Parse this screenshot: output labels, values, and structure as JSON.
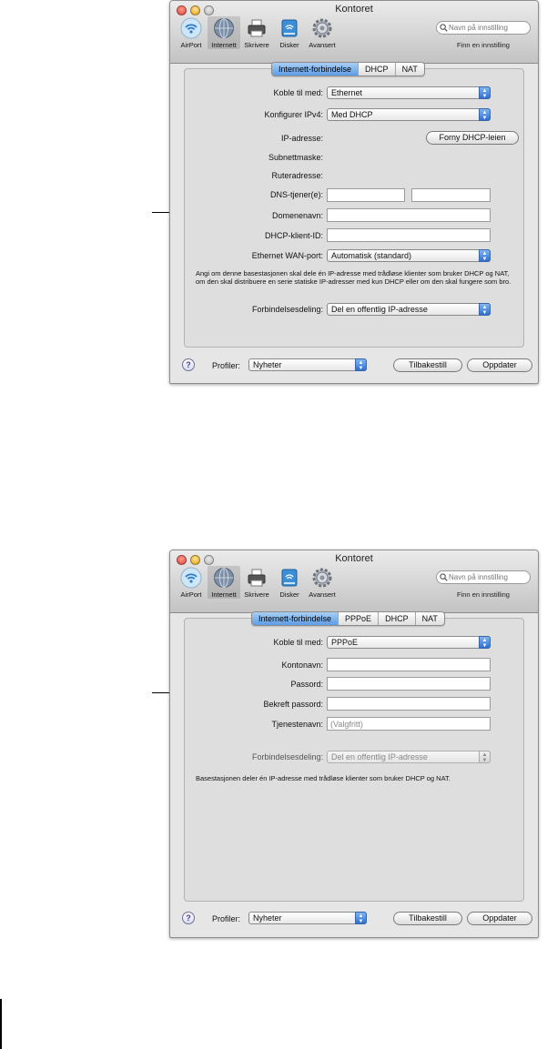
{
  "screens": [
    {
      "window_title": "Kontoret",
      "toolbar_items": [
        {
          "label": "AirPort",
          "icon": "airport-icon"
        },
        {
          "label": "Internett",
          "icon": "internet-globe-icon"
        },
        {
          "label": "Skrivere",
          "icon": "printer-icon"
        },
        {
          "label": "Disker",
          "icon": "disk-icon"
        },
        {
          "label": "Avansert",
          "icon": "gear-icon"
        }
      ],
      "search_placeholder": "Navn på innstilling",
      "search_caption": "Finn en innstilling",
      "tabs": [
        "Internett-forbindelse",
        "DHCP",
        "NAT"
      ],
      "active_tab": "Internett-forbindelse",
      "form": {
        "connect_with_label": "Koble til med:",
        "connect_with_value": "Ethernet",
        "configure_ipv4_label": "Konfigurer IPv4:",
        "configure_ipv4_value": "Med DHCP",
        "ip_address_label": "IP-adresse:",
        "renew_lease_button": "Forny DHCP-leien",
        "subnet_mask_label": "Subnettmaske:",
        "router_address_label": "Ruteradresse:",
        "dns_label": "DNS-tjener(e):",
        "domain_name_label": "Domenenavn:",
        "dhcp_client_id_label": "DHCP-klient-ID:",
        "wan_port_label": "Ethernet WAN-port:",
        "wan_port_value": "Automatisk (standard)",
        "note": "Angi om denne basestasjonen skal dele én IP-adresse med trådløse klienter som bruker DHCP og NAT, om den skal distribuere en serie statiske IP-adresser med kun DHCP eller om den skal fungere som bro.",
        "sharing_label": "Forbindelsesdeling:",
        "sharing_value": "Del en offentlig IP-adresse"
      },
      "footer": {
        "help": "?",
        "profiles_label": "Profiler:",
        "profiles_value": "Nyheter",
        "revert_button": "Tilbakestill",
        "update_button": "Oppdater"
      }
    },
    {
      "window_title": "Kontoret",
      "toolbar_items": [
        {
          "label": "AirPort",
          "icon": "airport-icon"
        },
        {
          "label": "Internett",
          "icon": "internet-globe-icon"
        },
        {
          "label": "Skrivere",
          "icon": "printer-icon"
        },
        {
          "label": "Disker",
          "icon": "disk-icon"
        },
        {
          "label": "Avansert",
          "icon": "gear-icon"
        }
      ],
      "search_placeholder": "Navn på innstilling",
      "search_caption": "Finn en innstilling",
      "tabs": [
        "Internett-forbindelse",
        "PPPoE",
        "DHCP",
        "NAT"
      ],
      "active_tab": "Internett-forbindelse",
      "form": {
        "connect_with_label": "Koble til med:",
        "connect_with_value": "PPPoE",
        "account_name_label": "Kontonavn:",
        "password_label": "Passord:",
        "confirm_password_label": "Bekreft passord:",
        "service_name_label": "Tjenestenavn:",
        "service_name_placeholder": "(Valgfritt)",
        "sharing_label": "Forbindelsesdeling:",
        "sharing_value": "Del en offentlig IP-adresse",
        "note": "Basestasjonen deler én IP-adresse med trådløse klienter som bruker DHCP og NAT."
      },
      "footer": {
        "help": "?",
        "profiles_label": "Profiler:",
        "profiles_value": "Nyheter",
        "revert_button": "Tilbakestill",
        "update_button": "Oppdater"
      }
    }
  ]
}
